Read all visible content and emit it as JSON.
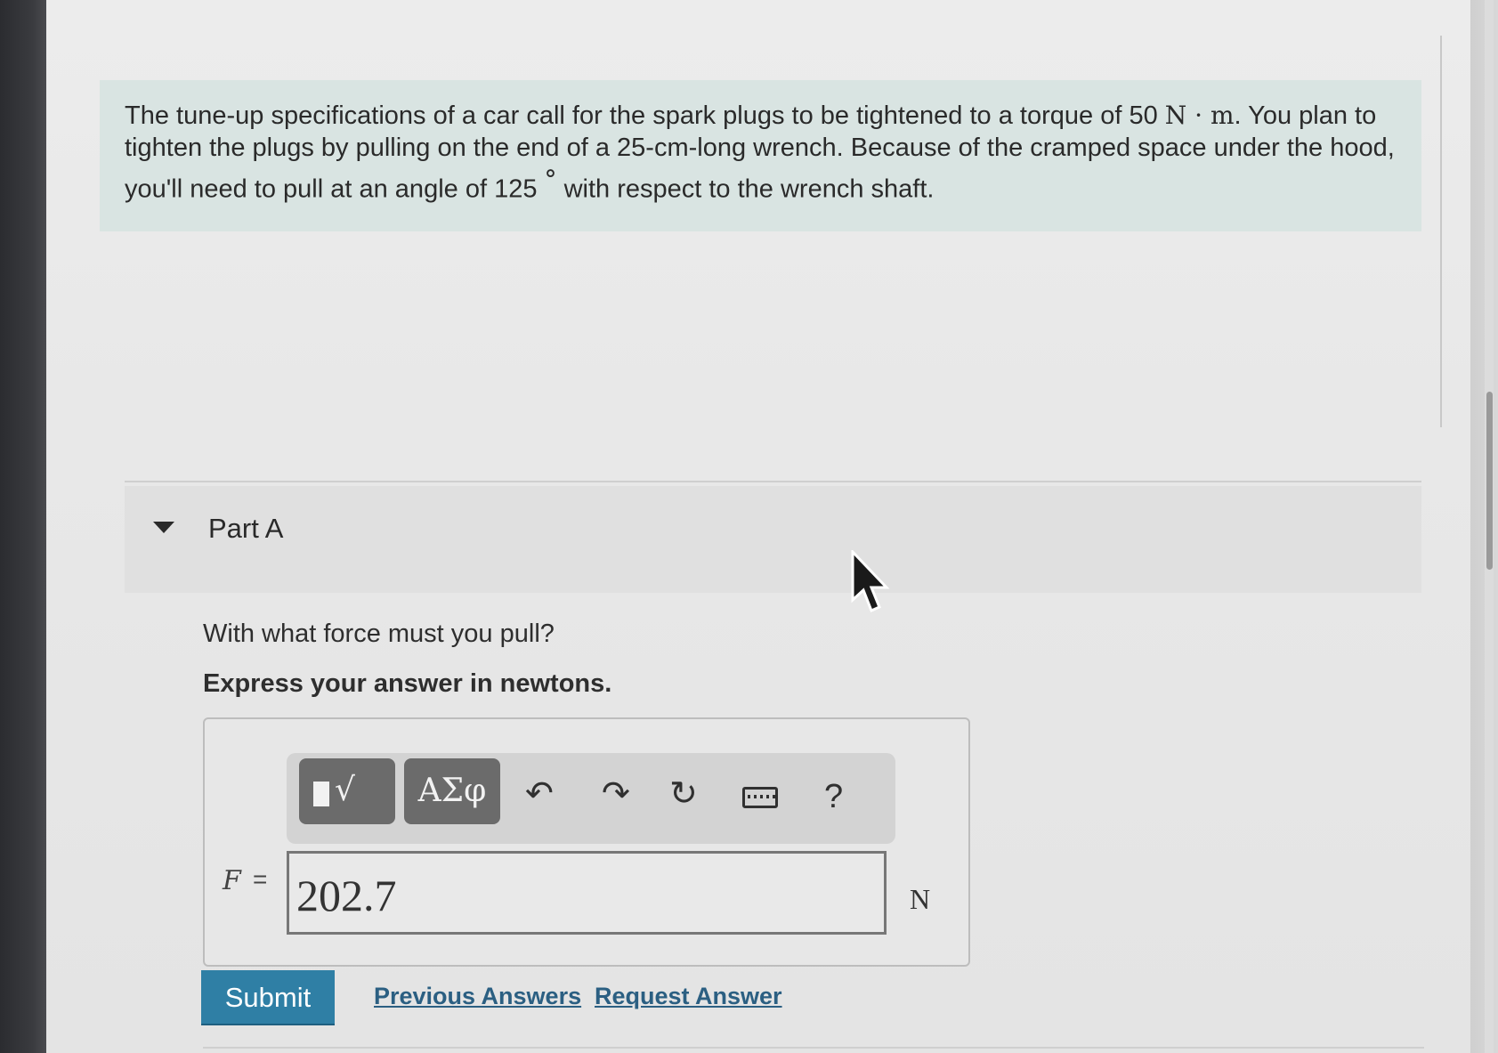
{
  "problem": {
    "text_1": "The tune-up specifications of a car call for the spark plugs to be tightened to a torque of 50",
    "torque_unit": "N · m",
    "text_2": ". You plan to tighten the plugs by pulling on the end of a 25-cm-long wrench. Because of the cramped space under the hood, you'll need to pull at an angle of 125",
    "angle_unit": "°",
    "text_3": "with respect to the wrench shaft."
  },
  "part": {
    "title": "Part A",
    "question": "With what force must you pull?",
    "instruction": "Express your answer in newtons."
  },
  "toolbar": {
    "templates_label": "√",
    "symbols_label": "ΑΣφ",
    "undo_glyph": "↶",
    "redo_glyph": "↷",
    "reset_glyph": "↻",
    "help_label": "?"
  },
  "answer": {
    "variable": "F",
    "equals": "=",
    "value": "202.7",
    "unit": "N"
  },
  "actions": {
    "submit_label": "Submit",
    "previous_answers_label": "Previous Answers",
    "request_answer_label": "Request Answer"
  },
  "colors": {
    "problem_bg": "#d9e4e2",
    "submit_bg": "#2f7fa5",
    "link": "#2b5f82",
    "toolbar_button": "#6b6b6b"
  }
}
